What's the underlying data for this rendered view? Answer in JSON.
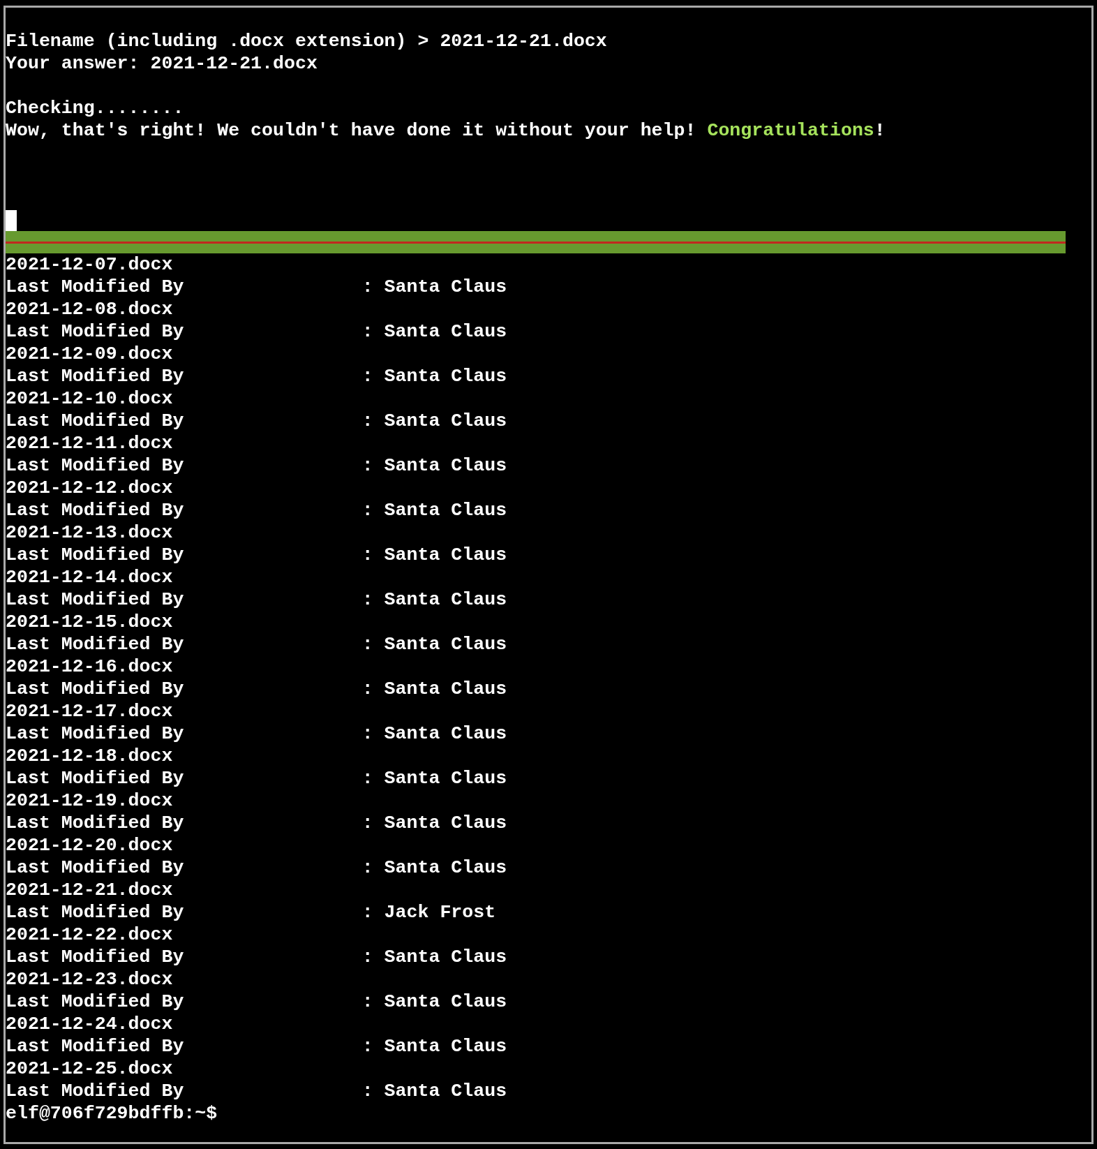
{
  "terminal": {
    "lines": [
      {
        "kind": "text",
        "segments": [
          {
            "text": "Filename (including .docx extension) > 2021-12-21.docx",
            "highlight": false
          }
        ]
      },
      {
        "kind": "text",
        "segments": [
          {
            "text": "Your answer: 2021-12-21.docx",
            "highlight": false
          }
        ]
      },
      {
        "kind": "blank"
      },
      {
        "kind": "text",
        "segments": [
          {
            "text": "Checking........",
            "highlight": false
          }
        ]
      },
      {
        "kind": "text",
        "segments": [
          {
            "text": "Wow, that's right! We couldn't have done it without your help! ",
            "highlight": false
          },
          {
            "text": "Congratulations",
            "highlight": true
          },
          {
            "text": "!",
            "highlight": false
          }
        ]
      },
      {
        "kind": "blank"
      },
      {
        "kind": "blank"
      },
      {
        "kind": "blank"
      },
      {
        "kind": "cursor"
      },
      {
        "kind": "banner"
      }
    ],
    "files": [
      {
        "name": "2021-12-07.docx",
        "field": "Last Modified By                : Santa Claus"
      },
      {
        "name": "2021-12-08.docx",
        "field": "Last Modified By                : Santa Claus"
      },
      {
        "name": "2021-12-09.docx",
        "field": "Last Modified By                : Santa Claus"
      },
      {
        "name": "2021-12-10.docx",
        "field": "Last Modified By                : Santa Claus"
      },
      {
        "name": "2021-12-11.docx",
        "field": "Last Modified By                : Santa Claus"
      },
      {
        "name": "2021-12-12.docx",
        "field": "Last Modified By                : Santa Claus"
      },
      {
        "name": "2021-12-13.docx",
        "field": "Last Modified By                : Santa Claus"
      },
      {
        "name": "2021-12-14.docx",
        "field": "Last Modified By                : Santa Claus"
      },
      {
        "name": "2021-12-15.docx",
        "field": "Last Modified By                : Santa Claus"
      },
      {
        "name": "2021-12-16.docx",
        "field": "Last Modified By                : Santa Claus"
      },
      {
        "name": "2021-12-17.docx",
        "field": "Last Modified By                : Santa Claus"
      },
      {
        "name": "2021-12-18.docx",
        "field": "Last Modified By                : Santa Claus"
      },
      {
        "name": "2021-12-19.docx",
        "field": "Last Modified By                : Santa Claus"
      },
      {
        "name": "2021-12-20.docx",
        "field": "Last Modified By                : Santa Claus"
      },
      {
        "name": "2021-12-21.docx",
        "field": "Last Modified By                : Jack Frost"
      },
      {
        "name": "2021-12-22.docx",
        "field": "Last Modified By                : Santa Claus"
      },
      {
        "name": "2021-12-23.docx",
        "field": "Last Modified By                : Santa Claus"
      },
      {
        "name": "2021-12-24.docx",
        "field": "Last Modified By                : Santa Claus"
      },
      {
        "name": "2021-12-25.docx",
        "field": "Last Modified By                : Santa Claus"
      }
    ],
    "prompt": "elf@706f729bdffb:~$"
  }
}
